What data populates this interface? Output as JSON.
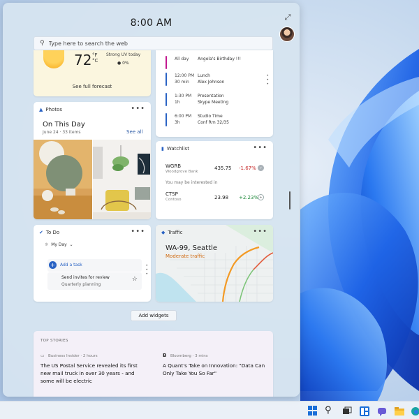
{
  "clock": "8:00 AM",
  "search": {
    "placeholder": "Type here to search the web"
  },
  "weather": {
    "temperature": "72",
    "unit": "°F\n°C",
    "condition": "Strong UV today",
    "precip": "0%",
    "link": "See full forecast"
  },
  "calendar": {
    "events": [
      {
        "time": "All day",
        "title": "Angela's Birthday !!!",
        "color": "#c2188f"
      },
      {
        "time": "12:00 PM\n30 min",
        "title": "Lunch\nAlex Johnson",
        "color": "#2a63c4"
      },
      {
        "time": "1:30 PM\n1h",
        "title": "Presentation\nSkype Meeting",
        "color": "#2a63c4"
      },
      {
        "time": "6:00 PM\n3h",
        "title": "Studio Time\nConf Rm 32/35",
        "color": "#2a63c4"
      }
    ]
  },
  "photos": {
    "header": "Photos",
    "title": "On This Day",
    "subtitle": "June 24 · 33 items",
    "see_all": "See all"
  },
  "watchlist": {
    "header": "Watchlist",
    "stocks": [
      {
        "symbol": "WGRB",
        "name": "Woodgrove Bank",
        "price": "435.75",
        "change": "-1.67%",
        "color": "#c62828"
      },
      {
        "symbol": "CTSP",
        "name": "Contoso",
        "price": "23.98",
        "change": "+2.23%",
        "color": "#1e8a3a"
      }
    ],
    "interest": "You may be interested in"
  },
  "todo": {
    "header": "To Do",
    "list": "My Day",
    "add": "Add a task",
    "task_title": "Send invites for review",
    "task_sub": "Quarterly planning"
  },
  "traffic": {
    "header": "Traffic",
    "route": "WA-99, Seattle",
    "status": "Moderate traffic"
  },
  "add_widgets": "Add widgets",
  "stories": {
    "header": "TOP STORIES",
    "items": [
      {
        "source": "Business Insider · 2 hours",
        "headline": "The US Postal Service revealed its first new mail truck in over 30 years - and some will be electric"
      },
      {
        "source": "Bloomberg · 3 mins",
        "headline": "A Quant's Take on Innovation: \"Data Can Only Take You So Far\""
      }
    ]
  },
  "colors": {
    "accent": "#1a6ed8",
    "panel": "#d6e4f0"
  }
}
